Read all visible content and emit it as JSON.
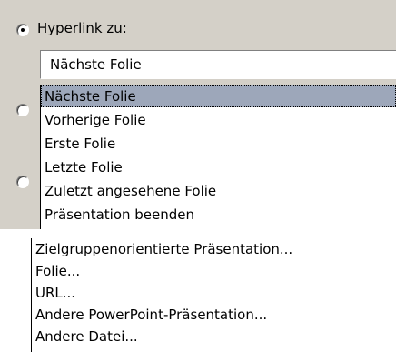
{
  "hyperlink_option": {
    "label": "Hyperlink zu:",
    "selected": true
  },
  "combo": {
    "value": "Nächste Folie"
  },
  "dropdown": {
    "items": [
      "Nächste Folie",
      "Vorherige Folie",
      "Erste Folie",
      "Letzte Folie",
      "Zuletzt angesehene Folie",
      "Präsentation beenden"
    ],
    "selected_index": 0
  },
  "more_items": [
    "Zielgruppenorientierte Präsentation...",
    "Folie...",
    "URL...",
    "Andere PowerPoint-Präsentation...",
    "Andere Datei..."
  ],
  "colors": {
    "panel": "#d4d0c8",
    "selection": "#9da7ba",
    "list_bg": "#ffffff"
  }
}
